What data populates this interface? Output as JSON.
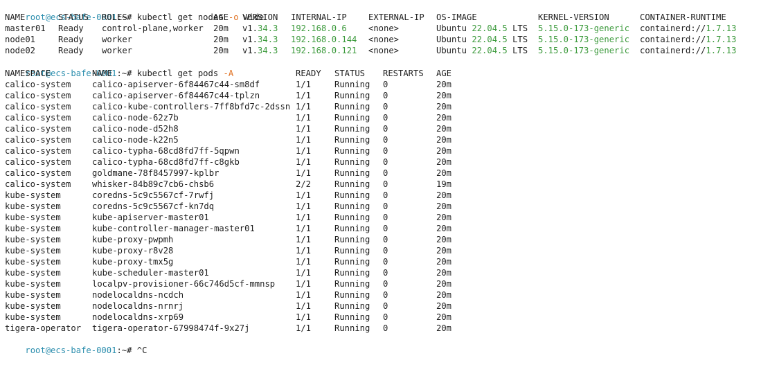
{
  "terminal": {
    "prompt_user": "root@ecs-bafe-0001",
    "prompt_sep": ":~# ",
    "cmd1": {
      "pre": "kubectl get nodes ",
      "flag": "-o",
      "post": " wide"
    },
    "cmd2": {
      "pre": "kubectl get pods ",
      "flag": "-A"
    },
    "cmd3": {
      "pre": "^C"
    },
    "nodes_headers": [
      "NAME",
      "STATUS",
      "ROLES",
      "AGE",
      "VERSION",
      "INTERNAL-IP",
      "EXTERNAL-IP",
      "OS-IMAGE",
      "KERNEL-VERSION",
      "CONTAINER-RUNTIME"
    ],
    "nodes": [
      {
        "name": "master01",
        "status": "Ready",
        "roles": "control-plane,worker",
        "age": "20m",
        "version": {
          "a": "v1.",
          "b": "34.3"
        },
        "internal_ip": "192.168.0.6",
        "external_ip": "<none>",
        "os": {
          "a": "Ubuntu ",
          "b": "22.04.5",
          "c": " LTS"
        },
        "kernel": "5.15.0-173-generic",
        "runtime": {
          "a": "containerd://",
          "b": "1.7.13"
        }
      },
      {
        "name": "node01",
        "status": "Ready",
        "roles": "worker",
        "age": "20m",
        "version": {
          "a": "v1.",
          "b": "34.3"
        },
        "internal_ip": "192.168.0.144",
        "external_ip": "<none>",
        "os": {
          "a": "Ubuntu ",
          "b": "22.04.5",
          "c": " LTS"
        },
        "kernel": "5.15.0-173-generic",
        "runtime": {
          "a": "containerd://",
          "b": "1.7.13"
        }
      },
      {
        "name": "node02",
        "status": "Ready",
        "roles": "worker",
        "age": "20m",
        "version": {
          "a": "v1.",
          "b": "34.3"
        },
        "internal_ip": "192.168.0.121",
        "external_ip": "<none>",
        "os": {
          "a": "Ubuntu ",
          "b": "22.04.5",
          "c": " LTS"
        },
        "kernel": "5.15.0-173-generic",
        "runtime": {
          "a": "containerd://",
          "b": "1.7.13"
        }
      }
    ],
    "pods_headers": [
      "NAMESPACE",
      "NAME",
      "READY",
      "STATUS",
      "RESTARTS",
      "AGE"
    ],
    "pods": [
      [
        "calico-system",
        "calico-apiserver-6f84467c44-sm8df",
        "1/1",
        "Running",
        "0",
        "20m"
      ],
      [
        "calico-system",
        "calico-apiserver-6f84467c44-tplzn",
        "1/1",
        "Running",
        "0",
        "20m"
      ],
      [
        "calico-system",
        "calico-kube-controllers-7ff8bfd7c-2dssn",
        "1/1",
        "Running",
        "0",
        "20m"
      ],
      [
        "calico-system",
        "calico-node-62z7b",
        "1/1",
        "Running",
        "0",
        "20m"
      ],
      [
        "calico-system",
        "calico-node-d52h8",
        "1/1",
        "Running",
        "0",
        "20m"
      ],
      [
        "calico-system",
        "calico-node-k22n5",
        "1/1",
        "Running",
        "0",
        "20m"
      ],
      [
        "calico-system",
        "calico-typha-68cd8fd7ff-5qpwn",
        "1/1",
        "Running",
        "0",
        "20m"
      ],
      [
        "calico-system",
        "calico-typha-68cd8fd7ff-c8gkb",
        "1/1",
        "Running",
        "0",
        "20m"
      ],
      [
        "calico-system",
        "goldmane-78f8457997-kplbr",
        "1/1",
        "Running",
        "0",
        "20m"
      ],
      [
        "calico-system",
        "whisker-84b89c7cb6-chsb6",
        "2/2",
        "Running",
        "0",
        "19m"
      ],
      [
        "kube-system",
        "coredns-5c9c5567cf-7rwfj",
        "1/1",
        "Running",
        "0",
        "20m"
      ],
      [
        "kube-system",
        "coredns-5c9c5567cf-kn7dq",
        "1/1",
        "Running",
        "0",
        "20m"
      ],
      [
        "kube-system",
        "kube-apiserver-master01",
        "1/1",
        "Running",
        "0",
        "20m"
      ],
      [
        "kube-system",
        "kube-controller-manager-master01",
        "1/1",
        "Running",
        "0",
        "20m"
      ],
      [
        "kube-system",
        "kube-proxy-pwpmh",
        "1/1",
        "Running",
        "0",
        "20m"
      ],
      [
        "kube-system",
        "kube-proxy-r8v28",
        "1/1",
        "Running",
        "0",
        "20m"
      ],
      [
        "kube-system",
        "kube-proxy-tmx5g",
        "1/1",
        "Running",
        "0",
        "20m"
      ],
      [
        "kube-system",
        "kube-scheduler-master01",
        "1/1",
        "Running",
        "0",
        "20m"
      ],
      [
        "kube-system",
        "localpv-provisioner-66c746d5cf-mmnsp",
        "1/1",
        "Running",
        "0",
        "20m"
      ],
      [
        "kube-system",
        "nodelocaldns-ncdch",
        "1/1",
        "Running",
        "0",
        "20m"
      ],
      [
        "kube-system",
        "nodelocaldns-nrnrj",
        "1/1",
        "Running",
        "0",
        "20m"
      ],
      [
        "kube-system",
        "nodelocaldns-xrp69",
        "1/1",
        "Running",
        "0",
        "20m"
      ],
      [
        "tigera-operator",
        "tigera-operator-67998474f-9x27j",
        "1/1",
        "Running",
        "0",
        "20m"
      ]
    ]
  }
}
